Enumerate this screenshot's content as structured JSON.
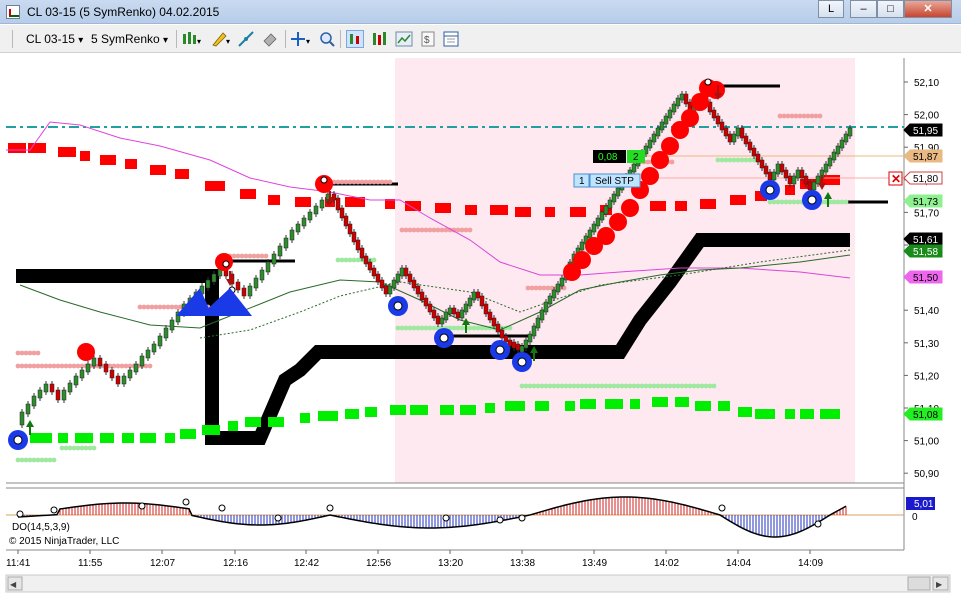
{
  "window": {
    "title": "CL 03-15 (5 SymRenko)  04.02.2015",
    "lang_button": "L",
    "minimize_symbol": "–",
    "maximize_symbol": "□",
    "close_symbol": "✕"
  },
  "toolbar": {
    "instrument": "CL 03-15",
    "period": "5 SymRenko",
    "dropdown_glyph": "▾"
  },
  "price_axis": {
    "labels": [
      "52,10",
      "52,00",
      "51,90",
      "51,80",
      "51,70",
      "51,60",
      "51,50",
      "51,40",
      "51,30",
      "51,20",
      "51,10",
      "51,00",
      "50,90"
    ],
    "tags": [
      {
        "text": "51,95",
        "bg": "#000000",
        "fg": "#ffffff"
      },
      {
        "text": "51,87",
        "bg": "#e8b982",
        "fg": "#000000"
      },
      {
        "text": "51,80",
        "bg": "#ffffff",
        "fg": "#000000"
      },
      {
        "text": "51,73",
        "bg": "#8ff08f",
        "fg": "#000000"
      },
      {
        "text": "51,61",
        "bg": "#000000",
        "fg": "#ffffff"
      },
      {
        "text": "51,58",
        "bg": "#1a8a1a",
        "fg": "#ffffff"
      },
      {
        "text": "51,50",
        "bg": "#ee66ee",
        "fg": "#000000"
      },
      {
        "text": "51,08",
        "bg": "#22ee22",
        "fg": "#000000"
      }
    ]
  },
  "time_axis": {
    "labels": [
      "11:41",
      "11:55",
      "12:07",
      "12:16",
      "12:42",
      "12:56",
      "13:20",
      "13:38",
      "13:49",
      "14:02",
      "14:04",
      "14:09"
    ]
  },
  "order": {
    "pnl": "0,08",
    "quantity": "2",
    "sell_qty": "1",
    "sell_label": "Sell STP"
  },
  "indicator": {
    "label": "DO(14,5,3,9)",
    "value_tag": "5,01",
    "zero_label": "0",
    "copyright": "© 2015 NinjaTrader, LLC"
  },
  "scrollbar": {
    "left_arrow": "◀",
    "right_arrow": "▶"
  },
  "colors": {
    "background": "#ffffff",
    "session_shade": "#fde9ef",
    "up_candle": "#2e8b2e",
    "down_candle": "#cc0000",
    "stop_red": "#ff0000",
    "stop_green": "#00ee00",
    "trend_black": "#000000",
    "dash_cyan": "#20a0a0",
    "magenta": "#dd44dd"
  }
}
